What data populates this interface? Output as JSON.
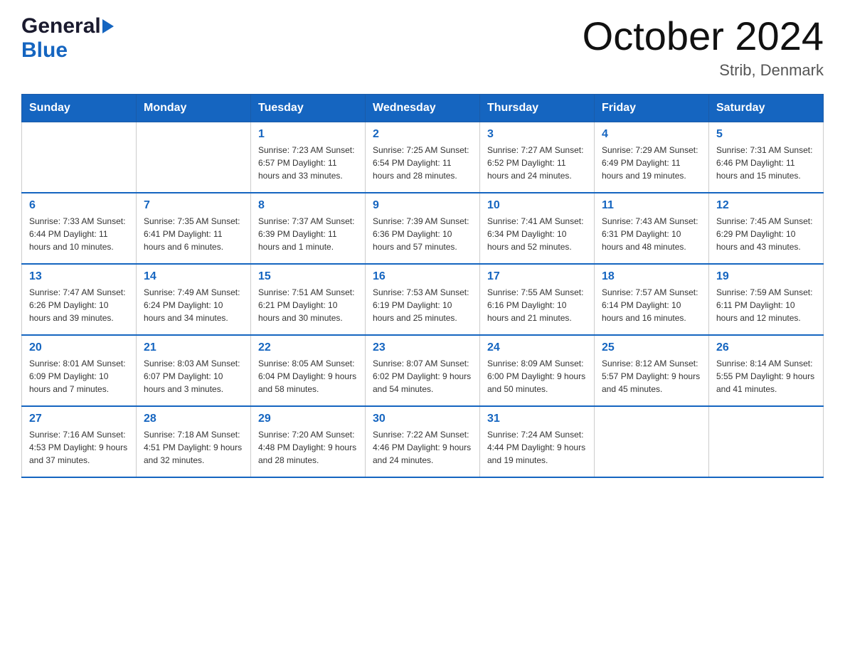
{
  "header": {
    "logo_general": "General",
    "logo_blue": "Blue",
    "month_title": "October 2024",
    "location": "Strib, Denmark"
  },
  "days_of_week": [
    "Sunday",
    "Monday",
    "Tuesday",
    "Wednesday",
    "Thursday",
    "Friday",
    "Saturday"
  ],
  "weeks": [
    [
      {
        "day": "",
        "info": ""
      },
      {
        "day": "",
        "info": ""
      },
      {
        "day": "1",
        "info": "Sunrise: 7:23 AM\nSunset: 6:57 PM\nDaylight: 11 hours\nand 33 minutes."
      },
      {
        "day": "2",
        "info": "Sunrise: 7:25 AM\nSunset: 6:54 PM\nDaylight: 11 hours\nand 28 minutes."
      },
      {
        "day": "3",
        "info": "Sunrise: 7:27 AM\nSunset: 6:52 PM\nDaylight: 11 hours\nand 24 minutes."
      },
      {
        "day": "4",
        "info": "Sunrise: 7:29 AM\nSunset: 6:49 PM\nDaylight: 11 hours\nand 19 minutes."
      },
      {
        "day": "5",
        "info": "Sunrise: 7:31 AM\nSunset: 6:46 PM\nDaylight: 11 hours\nand 15 minutes."
      }
    ],
    [
      {
        "day": "6",
        "info": "Sunrise: 7:33 AM\nSunset: 6:44 PM\nDaylight: 11 hours\nand 10 minutes."
      },
      {
        "day": "7",
        "info": "Sunrise: 7:35 AM\nSunset: 6:41 PM\nDaylight: 11 hours\nand 6 minutes."
      },
      {
        "day": "8",
        "info": "Sunrise: 7:37 AM\nSunset: 6:39 PM\nDaylight: 11 hours\nand 1 minute."
      },
      {
        "day": "9",
        "info": "Sunrise: 7:39 AM\nSunset: 6:36 PM\nDaylight: 10 hours\nand 57 minutes."
      },
      {
        "day": "10",
        "info": "Sunrise: 7:41 AM\nSunset: 6:34 PM\nDaylight: 10 hours\nand 52 minutes."
      },
      {
        "day": "11",
        "info": "Sunrise: 7:43 AM\nSunset: 6:31 PM\nDaylight: 10 hours\nand 48 minutes."
      },
      {
        "day": "12",
        "info": "Sunrise: 7:45 AM\nSunset: 6:29 PM\nDaylight: 10 hours\nand 43 minutes."
      }
    ],
    [
      {
        "day": "13",
        "info": "Sunrise: 7:47 AM\nSunset: 6:26 PM\nDaylight: 10 hours\nand 39 minutes."
      },
      {
        "day": "14",
        "info": "Sunrise: 7:49 AM\nSunset: 6:24 PM\nDaylight: 10 hours\nand 34 minutes."
      },
      {
        "day": "15",
        "info": "Sunrise: 7:51 AM\nSunset: 6:21 PM\nDaylight: 10 hours\nand 30 minutes."
      },
      {
        "day": "16",
        "info": "Sunrise: 7:53 AM\nSunset: 6:19 PM\nDaylight: 10 hours\nand 25 minutes."
      },
      {
        "day": "17",
        "info": "Sunrise: 7:55 AM\nSunset: 6:16 PM\nDaylight: 10 hours\nand 21 minutes."
      },
      {
        "day": "18",
        "info": "Sunrise: 7:57 AM\nSunset: 6:14 PM\nDaylight: 10 hours\nand 16 minutes."
      },
      {
        "day": "19",
        "info": "Sunrise: 7:59 AM\nSunset: 6:11 PM\nDaylight: 10 hours\nand 12 minutes."
      }
    ],
    [
      {
        "day": "20",
        "info": "Sunrise: 8:01 AM\nSunset: 6:09 PM\nDaylight: 10 hours\nand 7 minutes."
      },
      {
        "day": "21",
        "info": "Sunrise: 8:03 AM\nSunset: 6:07 PM\nDaylight: 10 hours\nand 3 minutes."
      },
      {
        "day": "22",
        "info": "Sunrise: 8:05 AM\nSunset: 6:04 PM\nDaylight: 9 hours\nand 58 minutes."
      },
      {
        "day": "23",
        "info": "Sunrise: 8:07 AM\nSunset: 6:02 PM\nDaylight: 9 hours\nand 54 minutes."
      },
      {
        "day": "24",
        "info": "Sunrise: 8:09 AM\nSunset: 6:00 PM\nDaylight: 9 hours\nand 50 minutes."
      },
      {
        "day": "25",
        "info": "Sunrise: 8:12 AM\nSunset: 5:57 PM\nDaylight: 9 hours\nand 45 minutes."
      },
      {
        "day": "26",
        "info": "Sunrise: 8:14 AM\nSunset: 5:55 PM\nDaylight: 9 hours\nand 41 minutes."
      }
    ],
    [
      {
        "day": "27",
        "info": "Sunrise: 7:16 AM\nSunset: 4:53 PM\nDaylight: 9 hours\nand 37 minutes."
      },
      {
        "day": "28",
        "info": "Sunrise: 7:18 AM\nSunset: 4:51 PM\nDaylight: 9 hours\nand 32 minutes."
      },
      {
        "day": "29",
        "info": "Sunrise: 7:20 AM\nSunset: 4:48 PM\nDaylight: 9 hours\nand 28 minutes."
      },
      {
        "day": "30",
        "info": "Sunrise: 7:22 AM\nSunset: 4:46 PM\nDaylight: 9 hours\nand 24 minutes."
      },
      {
        "day": "31",
        "info": "Sunrise: 7:24 AM\nSunset: 4:44 PM\nDaylight: 9 hours\nand 19 minutes."
      },
      {
        "day": "",
        "info": ""
      },
      {
        "day": "",
        "info": ""
      }
    ]
  ]
}
